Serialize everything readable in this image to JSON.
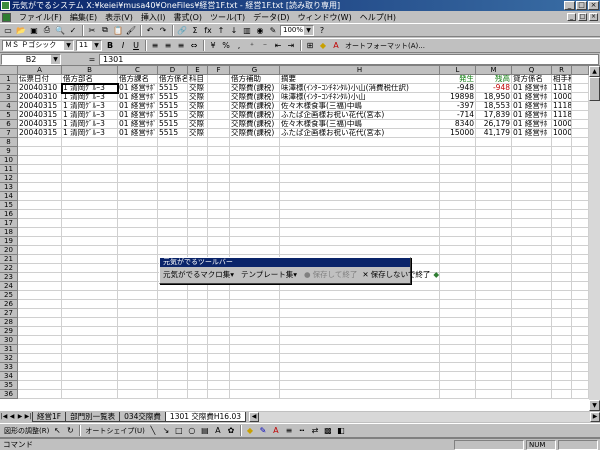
{
  "window": {
    "title": "元気がでるシステム  X:¥keiei¥musa40¥OneFiles¥経営1F.txt - 経営1F.txt [読み取り専用]",
    "buttons": [
      "_",
      "□",
      "×"
    ]
  },
  "menu": {
    "items": [
      "ファイル(F)",
      "編集(E)",
      "表示(V)",
      "挿入(I)",
      "書式(O)",
      "ツール(T)",
      "データ(D)",
      "ウィンドウ(W)",
      "ヘルプ(H)"
    ],
    "doc_buttons": [
      "_",
      "□",
      "×"
    ]
  },
  "toolbar": {
    "zoom": "100%",
    "font_name": "ＭＳ Ｐゴシック",
    "font_size": "11",
    "bold": "B",
    "italic": "I",
    "underline": "U",
    "sigma": "Σ",
    "fx": "fx",
    "autoformat": "オートフォーマット(A)..."
  },
  "formula_bar": {
    "name_box": "B2",
    "fx_symbol": "=",
    "value": "1301"
  },
  "sheet": {
    "columns": [
      "A",
      "B",
      "C",
      "D",
      "E",
      "F",
      "G",
      "H",
      "I",
      "L",
      "M",
      "Q",
      "R"
    ],
    "header_row": [
      "伝票日付",
      "借方部名",
      "借方課名",
      "借方係名",
      "科目",
      "",
      "借方補助",
      "摘要",
      "発生",
      "残高",
      "貸方係名",
      "相手科"
    ],
    "rows": [
      [
        "20040310",
        "1",
        "清岡ｸﾞﾙｰ3",
        "01",
        "経営ｻﾎﾟ",
        "5515",
        "交際",
        "交際費(課税)",
        "味澤様(ｲﾝﾀｰｺﾝﾁﾈﾝﾀﾙ)小山(消費税仕訳)",
        "-948",
        "-948",
        "01",
        "経営ｻﾎ",
        "1118"
      ],
      [
        "20040310",
        "1",
        "清岡ｸﾞﾙｰ3",
        "01",
        "経営ｻﾎﾟ",
        "5515",
        "交際",
        "交際費(課税)",
        "味澤様(ｲﾝﾀｰｺﾝﾁﾈﾝﾀﾙ)小山",
        "19898",
        "18,950",
        "01",
        "経営ｻﾎ",
        "1000"
      ],
      [
        "20040315",
        "1",
        "清岡ｸﾞﾙｰ3",
        "01",
        "経営ｻﾎﾟ",
        "5515",
        "交際",
        "交際費(課税)",
        "佐々木様食事(三福)中嶋",
        "-397",
        "18,553",
        "01",
        "経営ｻﾎ",
        "1118"
      ],
      [
        "20040315",
        "1",
        "清岡ｸﾞﾙｰ3",
        "01",
        "経営ｻﾎﾟ",
        "5515",
        "交際",
        "交際費(課税)",
        "ふたば企画様お祝い花代(宮本)",
        "-714",
        "17,839",
        "01",
        "経営ｻﾎ",
        "1118"
      ],
      [
        "20040315",
        "1",
        "清岡ｸﾞﾙｰ3",
        "01",
        "経営ｻﾎﾟ",
        "5515",
        "交際",
        "交際費(課税)",
        "佐々木様食事(三福)中嶋",
        "8340",
        "26,179",
        "01",
        "経営ｻﾎ",
        "1000"
      ],
      [
        "20040315",
        "1",
        "清岡ｸﾞﾙｰ3",
        "01",
        "経営ｻﾎﾟ",
        "5515",
        "交際",
        "交際費(課税)",
        "ふたば企画様お祝い花代(宮本)",
        "15000",
        "41,179",
        "01",
        "経営ｻﾎ",
        "1000"
      ]
    ],
    "row_numbers": [
      "1",
      "2",
      "3",
      "4",
      "5",
      "6",
      "7",
      "8",
      "9",
      "10",
      "11",
      "12",
      "13",
      "14",
      "15",
      "16",
      "17",
      "18",
      "19",
      "20",
      "21",
      "22",
      "23",
      "24",
      "25",
      "26",
      "27",
      "28",
      "29",
      "30",
      "31",
      "32",
      "33",
      "34",
      "35",
      "36"
    ]
  },
  "tabs": {
    "items": [
      "経営1F",
      "部門別一覧表",
      "034交際費",
      "1301 交際費H16.03"
    ],
    "active_index": 3
  },
  "floating_toolbar": {
    "title": "元気がでるツールバー",
    "items": [
      {
        "label": "元気がでるマクロ集",
        "enabled": true
      },
      {
        "label": "テンプレート集",
        "enabled": true
      },
      {
        "label": "保存して終了",
        "enabled": false
      },
      {
        "label": "保存しないで終了",
        "enabled": true
      }
    ]
  },
  "drawbar": {
    "draw_menu": "図形の調整(R)",
    "autoshape": "オートシェイプ(U)"
  },
  "status": {
    "text": "コマンド",
    "num": "NUM"
  }
}
